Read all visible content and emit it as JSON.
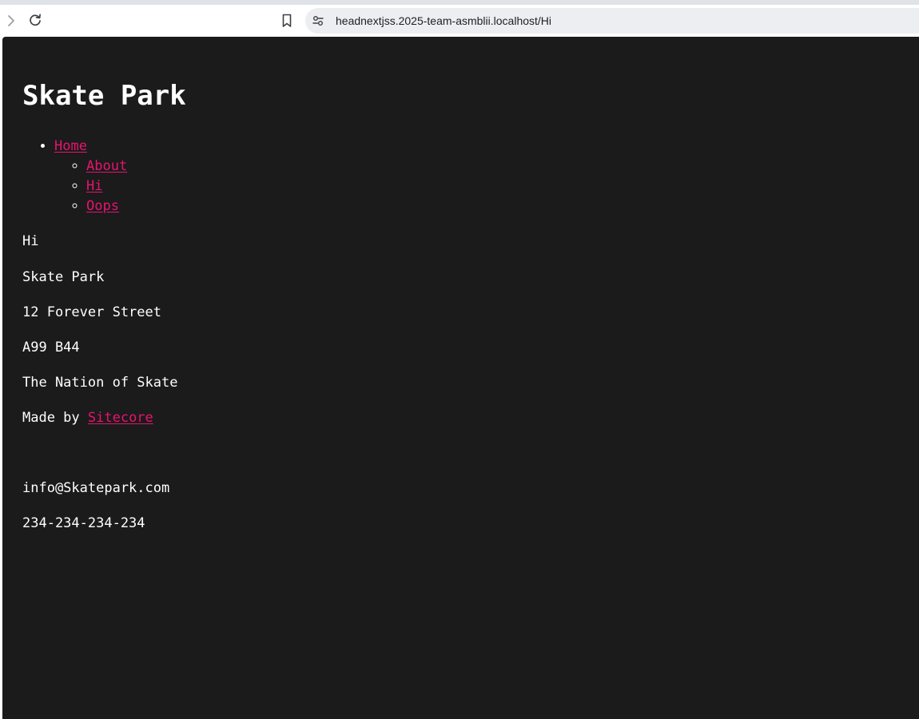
{
  "browser": {
    "url": "headnextjss.2025-team-asmblii.localhost/Hi",
    "forward_icon": "chevron-right-icon",
    "reload_icon": "reload-icon",
    "bookmark_icon": "bookmark-icon",
    "site_info_icon": "tune-icon"
  },
  "page": {
    "title": "Skate Park",
    "nav": {
      "home": "Home",
      "children": [
        "About",
        "Hi",
        "Oops"
      ]
    },
    "heading": "Hi",
    "address": {
      "name": "Skate Park",
      "street": "12 Forever Street",
      "postcode": "A99 B44",
      "country": "The Nation of Skate"
    },
    "made_by_prefix": "Made by ",
    "made_by_link": "Sitecore",
    "email": "info@Skatepark.com",
    "phone": "234-234-234-234"
  },
  "colors": {
    "page_background": "#1b1b1b",
    "text": "#ffffff",
    "link": "#e8136f",
    "address_bar": "#eceef2"
  }
}
